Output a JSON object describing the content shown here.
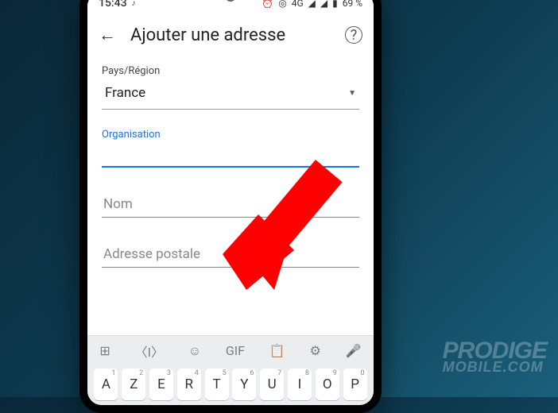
{
  "statusbar": {
    "time": "15:43",
    "battery": "69 %",
    "network": "4G"
  },
  "appbar": {
    "title": "Ajouter une adresse"
  },
  "form": {
    "country_label": "Pays/Région",
    "country_value": "France",
    "organisation_label": "Organisation",
    "organisation_value": "",
    "name_label": "Nom",
    "postal_label": "Adresse postale"
  },
  "keyboard": {
    "toolbar": {
      "gif": "GIF"
    },
    "keys": [
      "A",
      "Z",
      "E",
      "R",
      "T",
      "Y",
      "U",
      "I",
      "O",
      "P"
    ],
    "key_digits": [
      "1",
      "2",
      "3",
      "4",
      "5",
      "6",
      "7",
      "8",
      "9",
      "0"
    ]
  },
  "watermark": {
    "line1": "PRODIGE",
    "line2": "MOBILE.COM"
  }
}
